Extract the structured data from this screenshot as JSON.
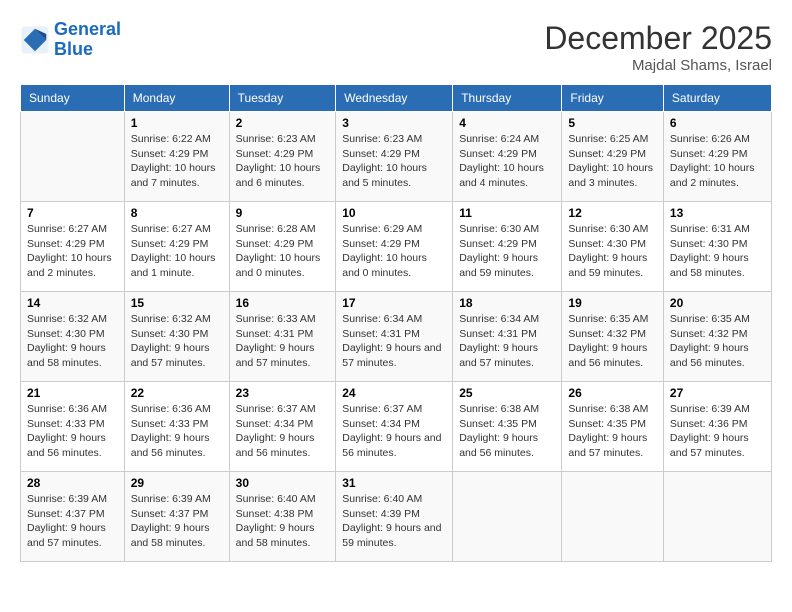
{
  "logo": {
    "line1": "General",
    "line2": "Blue"
  },
  "title": "December 2025",
  "location": "Majdal Shams, Israel",
  "weekdays": [
    "Sunday",
    "Monday",
    "Tuesday",
    "Wednesday",
    "Thursday",
    "Friday",
    "Saturday"
  ],
  "weeks": [
    [
      {
        "day": "",
        "sunrise": "",
        "sunset": "",
        "daylight": ""
      },
      {
        "day": "1",
        "sunrise": "Sunrise: 6:22 AM",
        "sunset": "Sunset: 4:29 PM",
        "daylight": "Daylight: 10 hours and 7 minutes."
      },
      {
        "day": "2",
        "sunrise": "Sunrise: 6:23 AM",
        "sunset": "Sunset: 4:29 PM",
        "daylight": "Daylight: 10 hours and 6 minutes."
      },
      {
        "day": "3",
        "sunrise": "Sunrise: 6:23 AM",
        "sunset": "Sunset: 4:29 PM",
        "daylight": "Daylight: 10 hours and 5 minutes."
      },
      {
        "day": "4",
        "sunrise": "Sunrise: 6:24 AM",
        "sunset": "Sunset: 4:29 PM",
        "daylight": "Daylight: 10 hours and 4 minutes."
      },
      {
        "day": "5",
        "sunrise": "Sunrise: 6:25 AM",
        "sunset": "Sunset: 4:29 PM",
        "daylight": "Daylight: 10 hours and 3 minutes."
      },
      {
        "day": "6",
        "sunrise": "Sunrise: 6:26 AM",
        "sunset": "Sunset: 4:29 PM",
        "daylight": "Daylight: 10 hours and 2 minutes."
      }
    ],
    [
      {
        "day": "7",
        "sunrise": "Sunrise: 6:27 AM",
        "sunset": "Sunset: 4:29 PM",
        "daylight": "Daylight: 10 hours and 2 minutes."
      },
      {
        "day": "8",
        "sunrise": "Sunrise: 6:27 AM",
        "sunset": "Sunset: 4:29 PM",
        "daylight": "Daylight: 10 hours and 1 minute."
      },
      {
        "day": "9",
        "sunrise": "Sunrise: 6:28 AM",
        "sunset": "Sunset: 4:29 PM",
        "daylight": "Daylight: 10 hours and 0 minutes."
      },
      {
        "day": "10",
        "sunrise": "Sunrise: 6:29 AM",
        "sunset": "Sunset: 4:29 PM",
        "daylight": "Daylight: 10 hours and 0 minutes."
      },
      {
        "day": "11",
        "sunrise": "Sunrise: 6:30 AM",
        "sunset": "Sunset: 4:29 PM",
        "daylight": "Daylight: 9 hours and 59 minutes."
      },
      {
        "day": "12",
        "sunrise": "Sunrise: 6:30 AM",
        "sunset": "Sunset: 4:30 PM",
        "daylight": "Daylight: 9 hours and 59 minutes."
      },
      {
        "day": "13",
        "sunrise": "Sunrise: 6:31 AM",
        "sunset": "Sunset: 4:30 PM",
        "daylight": "Daylight: 9 hours and 58 minutes."
      }
    ],
    [
      {
        "day": "14",
        "sunrise": "Sunrise: 6:32 AM",
        "sunset": "Sunset: 4:30 PM",
        "daylight": "Daylight: 9 hours and 58 minutes."
      },
      {
        "day": "15",
        "sunrise": "Sunrise: 6:32 AM",
        "sunset": "Sunset: 4:30 PM",
        "daylight": "Daylight: 9 hours and 57 minutes."
      },
      {
        "day": "16",
        "sunrise": "Sunrise: 6:33 AM",
        "sunset": "Sunset: 4:31 PM",
        "daylight": "Daylight: 9 hours and 57 minutes."
      },
      {
        "day": "17",
        "sunrise": "Sunrise: 6:34 AM",
        "sunset": "Sunset: 4:31 PM",
        "daylight": "Daylight: 9 hours and 57 minutes."
      },
      {
        "day": "18",
        "sunrise": "Sunrise: 6:34 AM",
        "sunset": "Sunset: 4:31 PM",
        "daylight": "Daylight: 9 hours and 57 minutes."
      },
      {
        "day": "19",
        "sunrise": "Sunrise: 6:35 AM",
        "sunset": "Sunset: 4:32 PM",
        "daylight": "Daylight: 9 hours and 56 minutes."
      },
      {
        "day": "20",
        "sunrise": "Sunrise: 6:35 AM",
        "sunset": "Sunset: 4:32 PM",
        "daylight": "Daylight: 9 hours and 56 minutes."
      }
    ],
    [
      {
        "day": "21",
        "sunrise": "Sunrise: 6:36 AM",
        "sunset": "Sunset: 4:33 PM",
        "daylight": "Daylight: 9 hours and 56 minutes."
      },
      {
        "day": "22",
        "sunrise": "Sunrise: 6:36 AM",
        "sunset": "Sunset: 4:33 PM",
        "daylight": "Daylight: 9 hours and 56 minutes."
      },
      {
        "day": "23",
        "sunrise": "Sunrise: 6:37 AM",
        "sunset": "Sunset: 4:34 PM",
        "daylight": "Daylight: 9 hours and 56 minutes."
      },
      {
        "day": "24",
        "sunrise": "Sunrise: 6:37 AM",
        "sunset": "Sunset: 4:34 PM",
        "daylight": "Daylight: 9 hours and 56 minutes."
      },
      {
        "day": "25",
        "sunrise": "Sunrise: 6:38 AM",
        "sunset": "Sunset: 4:35 PM",
        "daylight": "Daylight: 9 hours and 56 minutes."
      },
      {
        "day": "26",
        "sunrise": "Sunrise: 6:38 AM",
        "sunset": "Sunset: 4:35 PM",
        "daylight": "Daylight: 9 hours and 57 minutes."
      },
      {
        "day": "27",
        "sunrise": "Sunrise: 6:39 AM",
        "sunset": "Sunset: 4:36 PM",
        "daylight": "Daylight: 9 hours and 57 minutes."
      }
    ],
    [
      {
        "day": "28",
        "sunrise": "Sunrise: 6:39 AM",
        "sunset": "Sunset: 4:37 PM",
        "daylight": "Daylight: 9 hours and 57 minutes."
      },
      {
        "day": "29",
        "sunrise": "Sunrise: 6:39 AM",
        "sunset": "Sunset: 4:37 PM",
        "daylight": "Daylight: 9 hours and 58 minutes."
      },
      {
        "day": "30",
        "sunrise": "Sunrise: 6:40 AM",
        "sunset": "Sunset: 4:38 PM",
        "daylight": "Daylight: 9 hours and 58 minutes."
      },
      {
        "day": "31",
        "sunrise": "Sunrise: 6:40 AM",
        "sunset": "Sunset: 4:39 PM",
        "daylight": "Daylight: 9 hours and 59 minutes."
      },
      {
        "day": "",
        "sunrise": "",
        "sunset": "",
        "daylight": ""
      },
      {
        "day": "",
        "sunrise": "",
        "sunset": "",
        "daylight": ""
      },
      {
        "day": "",
        "sunrise": "",
        "sunset": "",
        "daylight": ""
      }
    ]
  ]
}
